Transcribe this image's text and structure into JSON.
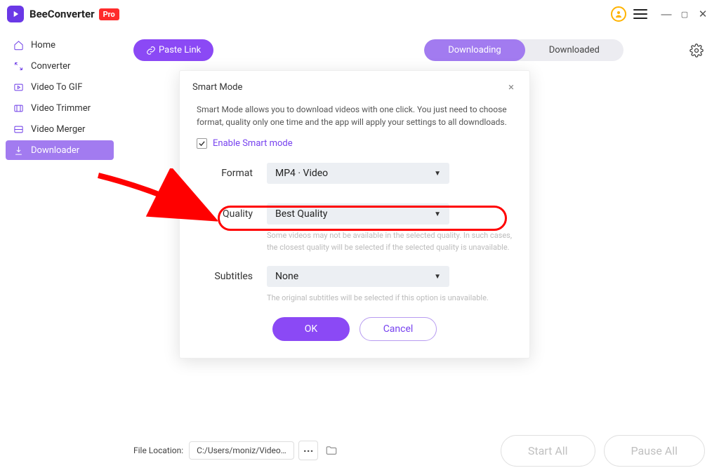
{
  "app": {
    "name": "BeeConverter",
    "badge": "Pro"
  },
  "sidebar": {
    "items": [
      {
        "label": "Home"
      },
      {
        "label": "Converter"
      },
      {
        "label": "Video To GIF"
      },
      {
        "label": "Video Trimmer"
      },
      {
        "label": "Video Merger"
      },
      {
        "label": "Downloader"
      }
    ]
  },
  "topbar": {
    "paste": "Paste Link",
    "seg": {
      "downloading": "Downloading",
      "downloaded": "Downloaded"
    }
  },
  "modal": {
    "title": "Smart Mode",
    "desc": "Smart Mode allows you to download videos with one click. You just need to choose format, quality only one time and the app will apply your settings to all downdloads.",
    "enable": "Enable Smart mode",
    "format_label": "Format",
    "format_value": "MP4 · Video",
    "quality_label": "Quality",
    "quality_value": "Best Quality",
    "quality_hint": "Some videos may not be available in the selected quality. In such cases, the closest  quality will be selected if the selected quality is unavailable.",
    "subtitles_label": "Subtitles",
    "subtitles_value": "None",
    "subtitles_hint": "The original subtitles will be selected if this option is unavailable.",
    "ok": "OK",
    "cancel": "Cancel"
  },
  "footer": {
    "file_loc_label": "File Location:",
    "file_loc_value": "C:/Users/moniz/Videos/BeeConverter",
    "start_all": "Start All",
    "pause_all": "Pause All"
  }
}
